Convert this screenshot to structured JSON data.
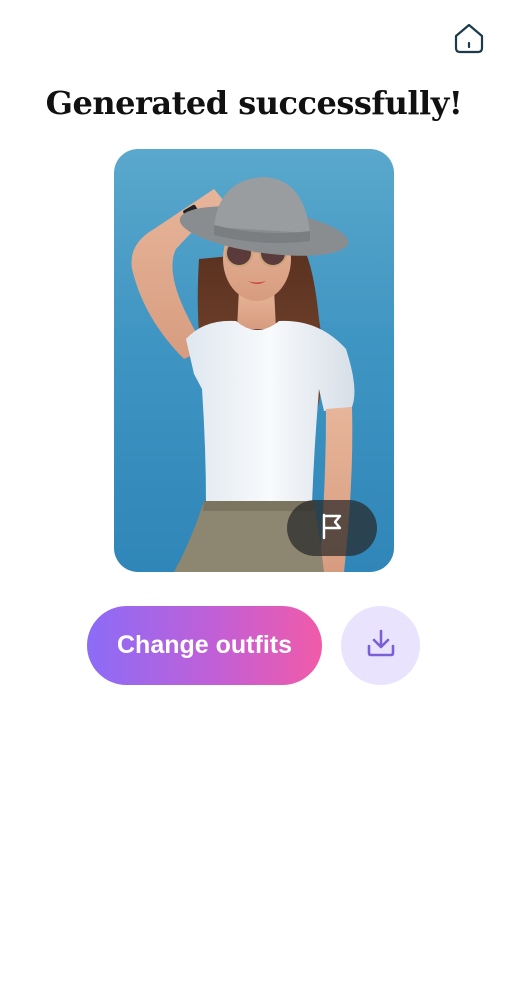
{
  "header": {
    "home_icon": "home-icon"
  },
  "title": "Generated successfully!",
  "result_image": {
    "description_icon": "generated-outfit-photo",
    "report_icon": "flag-icon"
  },
  "actions": {
    "change_outfits_label": "Change outfits",
    "download_icon": "download-icon"
  },
  "colors": {
    "gradient_start": "#8b6cf7",
    "gradient_end": "#f15ba8",
    "download_bg": "#e9e3fd",
    "download_icon": "#7a5fd6"
  }
}
